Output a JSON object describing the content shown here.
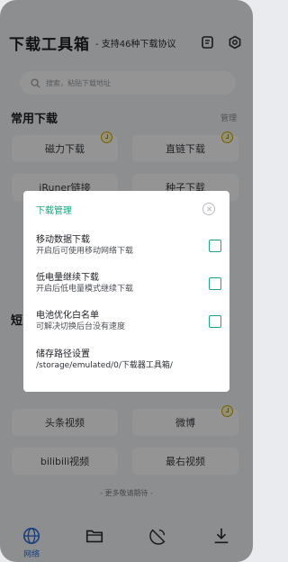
{
  "header": {
    "title": "下载工具箱",
    "separator": "-",
    "subtitle": "支持46种下载协议"
  },
  "search": {
    "placeholder": "搜索，粘贴下载地址"
  },
  "section1": {
    "title": "常用下载",
    "more": "管理",
    "tiles": [
      "磁力下载",
      "直链下载",
      "iRuner链接",
      "种子下载"
    ]
  },
  "section2": {
    "title": "短",
    "tiles": [
      "头条视频",
      "微博",
      "bilibili视频",
      "最右视频"
    ]
  },
  "more_note": "- 更多敬请期待 -",
  "bottom_nav": {
    "web_label": "网络"
  },
  "dialog": {
    "title": "下载管理",
    "settings": [
      {
        "title": "移动数据下载",
        "desc": "开启后可使用移动网络下载"
      },
      {
        "title": "低电量继续下载",
        "desc": "开启后低电量模式继续下载"
      },
      {
        "title": "电池优化白名单",
        "desc": "可解决切换后台没有速度"
      }
    ],
    "path_title": "储存路径设置",
    "path_value": "/storage/emulated/0/下载器工具箱/"
  },
  "colors": {
    "accent": "#1aa37a",
    "checkbox": "#22a088",
    "nav_active": "#2f6fdd"
  }
}
